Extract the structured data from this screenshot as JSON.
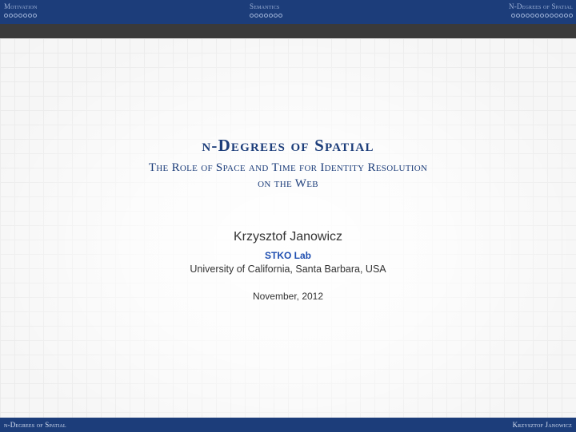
{
  "navbar": {
    "sections": [
      {
        "label": "Motivation",
        "dots": 7
      },
      {
        "label": "Semantics",
        "dots": 7
      },
      {
        "label": "N-Degrees of Spatial",
        "dots": 13
      }
    ]
  },
  "slide": {
    "title": "n-Degrees of Spatial",
    "subtitle_line1": "The Role of Space and Time for Identity Resolution",
    "subtitle_line2": "on the Web",
    "author": "Krzysztof Janowicz",
    "lab": "STKO Lab",
    "institution": "University of California, Santa Barbara, USA",
    "date": "November, 2012"
  },
  "footer": {
    "left": "n-Degrees of Spatial",
    "right": "Krzysztof Janowicz"
  },
  "colors": {
    "bar": "#1c3d7a",
    "subbar": "#3a3a3a",
    "title": "#1c3d7a",
    "lab": "#1f4fb0"
  }
}
